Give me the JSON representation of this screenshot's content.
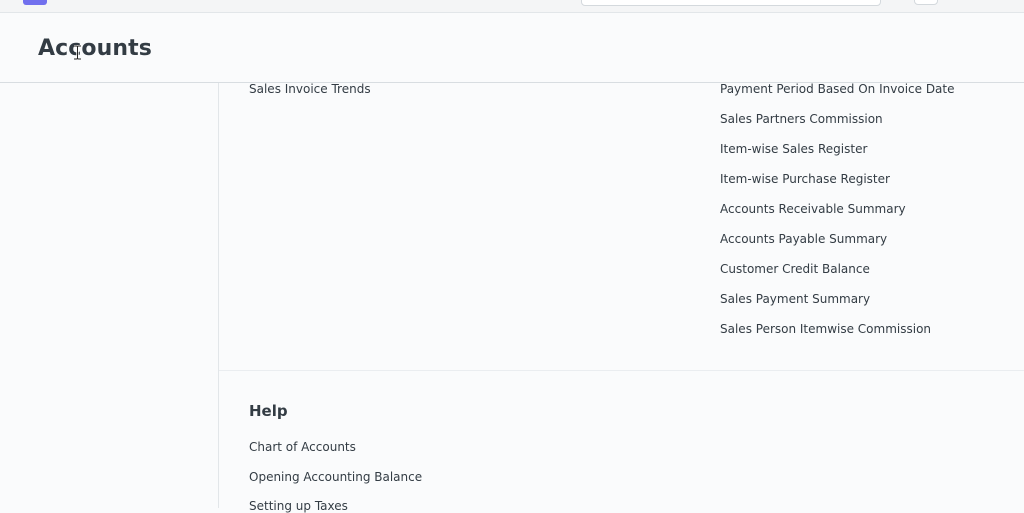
{
  "page": {
    "title": "Accounts"
  },
  "reports": {
    "left_column": [
      {
        "label": "Sales Invoice Trends"
      }
    ],
    "right_column": [
      {
        "label": "Payment Period Based On Invoice Date"
      },
      {
        "label": "Sales Partners Commission"
      },
      {
        "label": "Item-wise Sales Register"
      },
      {
        "label": "Item-wise Purchase Register"
      },
      {
        "label": "Accounts Receivable Summary"
      },
      {
        "label": "Accounts Payable Summary"
      },
      {
        "label": "Customer Credit Balance"
      },
      {
        "label": "Sales Payment Summary"
      },
      {
        "label": "Sales Person Itemwise Commission"
      }
    ]
  },
  "help": {
    "title": "Help",
    "links": [
      {
        "label": "Chart of Accounts"
      },
      {
        "label": "Opening Accounting Balance"
      },
      {
        "label": "Setting up Taxes"
      }
    ]
  },
  "colors": {
    "brand": "#7170ee",
    "text": "#333c44",
    "border": "#d8dde1"
  },
  "icons": {
    "cursor": "text-cursor-icon",
    "logo": "app-logo-icon"
  }
}
